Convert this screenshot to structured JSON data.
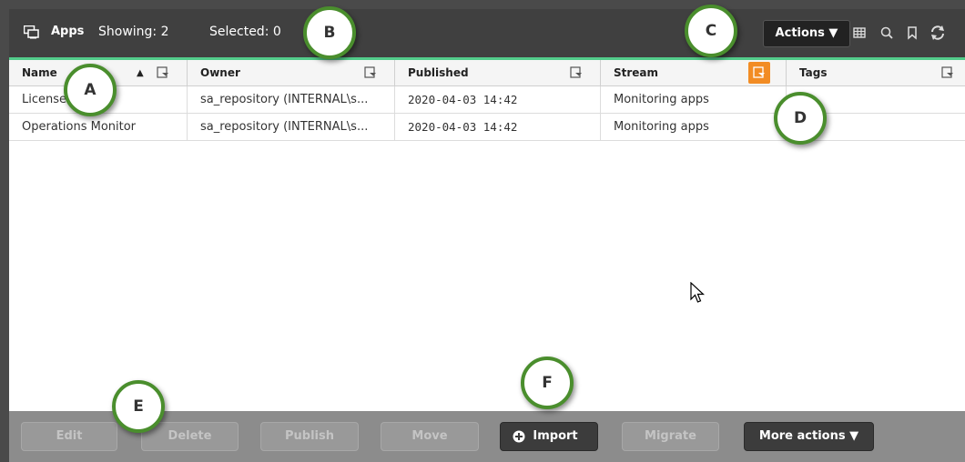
{
  "topbar": {
    "apps_label": "Apps",
    "showing_label": "Showing: 2",
    "selected_label": "Selected: 0",
    "actions_label": "Actions ▼",
    "icons": [
      "apps-icon",
      "table-view-icon",
      "search-icon",
      "bookmark-icon",
      "refresh-icon"
    ]
  },
  "table": {
    "columns": [
      {
        "label": "Name",
        "sort": "▲"
      },
      {
        "label": "Owner"
      },
      {
        "label": "Published"
      },
      {
        "label": "Stream"
      },
      {
        "label": "Tags"
      }
    ],
    "rows": [
      [
        "License Monitor",
        "sa_repository (INTERNAL\\s...",
        "2020-04-03 14:42",
        "Monitoring apps",
        ""
      ],
      [
        "Operations Monitor",
        "sa_repository (INTERNAL\\s...",
        "2020-04-03 14:42",
        "Monitoring apps",
        ""
      ]
    ]
  },
  "bottombar": {
    "edit": "Edit",
    "delete": "Delete",
    "publish": "Publish",
    "move": "Move",
    "import": "Import",
    "migrate": "Migrate",
    "more_actions": "More actions ▼"
  },
  "callouts": [
    "A",
    "B",
    "C",
    "D",
    "E",
    "F"
  ],
  "colors": {
    "accent_green": "#52cc8a",
    "filter_active": "#f28c24",
    "callout_border": "#4a8e2d",
    "toolbar_bg": "#404040"
  }
}
